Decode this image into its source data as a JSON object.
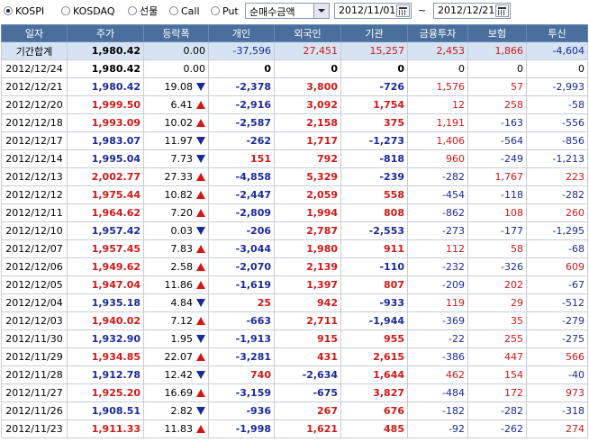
{
  "markets": [
    {
      "label": "KOSPI",
      "selected": true
    },
    {
      "label": "KOSDAQ",
      "selected": false
    },
    {
      "label": "선물",
      "selected": false
    },
    {
      "label": "Call",
      "selected": false
    },
    {
      "label": "Put",
      "selected": false
    }
  ],
  "metric_select": {
    "value": "순매수금액"
  },
  "date_from": "2012/11/01",
  "date_to": "2012/12/21",
  "range_sep": "~",
  "columns": [
    "일자",
    "주가",
    "등락폭",
    "개인",
    "외국인",
    "기관",
    "금융투자",
    "보험",
    "투신"
  ],
  "summary": {
    "date": "기간합계",
    "price": "1,980.42",
    "change": "0.00",
    "individual": "-37,596",
    "foreign": "27,451",
    "institution": "15,257",
    "fin_invest": "2,453",
    "insurance": "1,866",
    "trust": "-4,604"
  },
  "rows": [
    {
      "date": "2012/12/24",
      "price": "1,980.42",
      "change": "0.00",
      "dir": "none",
      "individual": "0",
      "foreign": "0",
      "institution": "0",
      "fin_invest": "0",
      "insurance": "0",
      "trust": "0"
    },
    {
      "date": "2012/12/21",
      "price": "1,980.42",
      "change": "19.08",
      "dir": "down",
      "individual": "-2,378",
      "foreign": "3,800",
      "institution": "-726",
      "fin_invest": "1,576",
      "insurance": "57",
      "trust": "-2,993"
    },
    {
      "date": "2012/12/20",
      "price": "1,999.50",
      "change": "6.41",
      "dir": "up",
      "individual": "-2,916",
      "foreign": "3,092",
      "institution": "1,754",
      "fin_invest": "12",
      "insurance": "258",
      "trust": "-58"
    },
    {
      "date": "2012/12/18",
      "price": "1,993.09",
      "change": "10.02",
      "dir": "up",
      "individual": "-2,587",
      "foreign": "2,158",
      "institution": "375",
      "fin_invest": "1,191",
      "insurance": "-163",
      "trust": "-556"
    },
    {
      "date": "2012/12/17",
      "price": "1,983.07",
      "change": "11.97",
      "dir": "down",
      "individual": "-262",
      "foreign": "1,717",
      "institution": "-1,273",
      "fin_invest": "1,406",
      "insurance": "-564",
      "trust": "-856"
    },
    {
      "date": "2012/12/14",
      "price": "1,995.04",
      "change": "7.73",
      "dir": "down",
      "individual": "151",
      "foreign": "792",
      "institution": "-818",
      "fin_invest": "960",
      "insurance": "-249",
      "trust": "-1,213"
    },
    {
      "date": "2012/12/13",
      "price": "2,002.77",
      "change": "27.33",
      "dir": "up",
      "individual": "-4,858",
      "foreign": "5,329",
      "institution": "-239",
      "fin_invest": "-282",
      "insurance": "1,767",
      "trust": "223"
    },
    {
      "date": "2012/12/12",
      "price": "1,975.44",
      "change": "10.82",
      "dir": "up",
      "individual": "-2,447",
      "foreign": "2,059",
      "institution": "558",
      "fin_invest": "-454",
      "insurance": "-118",
      "trust": "-282"
    },
    {
      "date": "2012/12/11",
      "price": "1,964.62",
      "change": "7.20",
      "dir": "up",
      "individual": "-2,809",
      "foreign": "1,994",
      "institution": "808",
      "fin_invest": "-862",
      "insurance": "108",
      "trust": "260"
    },
    {
      "date": "2012/12/10",
      "price": "1,957.42",
      "change": "0.03",
      "dir": "down",
      "individual": "-206",
      "foreign": "2,787",
      "institution": "-2,553",
      "fin_invest": "-273",
      "insurance": "-177",
      "trust": "-1,295"
    },
    {
      "date": "2012/12/07",
      "price": "1,957.45",
      "change": "7.83",
      "dir": "up",
      "individual": "-3,044",
      "foreign": "1,980",
      "institution": "911",
      "fin_invest": "112",
      "insurance": "58",
      "trust": "-68"
    },
    {
      "date": "2012/12/06",
      "price": "1,949.62",
      "change": "2.58",
      "dir": "up",
      "individual": "-2,070",
      "foreign": "2,139",
      "institution": "-110",
      "fin_invest": "-232",
      "insurance": "-326",
      "trust": "609"
    },
    {
      "date": "2012/12/05",
      "price": "1,947.04",
      "change": "11.86",
      "dir": "up",
      "individual": "-1,619",
      "foreign": "1,397",
      "institution": "807",
      "fin_invest": "-209",
      "insurance": "202",
      "trust": "-67"
    },
    {
      "date": "2012/12/04",
      "price": "1,935.18",
      "change": "4.84",
      "dir": "down",
      "individual": "25",
      "foreign": "942",
      "institution": "-933",
      "fin_invest": "119",
      "insurance": "29",
      "trust": "-512"
    },
    {
      "date": "2012/12/03",
      "price": "1,940.02",
      "change": "7.12",
      "dir": "up",
      "individual": "-663",
      "foreign": "2,711",
      "institution": "-1,944",
      "fin_invest": "-369",
      "insurance": "35",
      "trust": "-279"
    },
    {
      "date": "2012/11/30",
      "price": "1,932.90",
      "change": "1.95",
      "dir": "down",
      "individual": "-1,913",
      "foreign": "915",
      "institution": "955",
      "fin_invest": "-22",
      "insurance": "255",
      "trust": "-275"
    },
    {
      "date": "2012/11/29",
      "price": "1,934.85",
      "change": "22.07",
      "dir": "up",
      "individual": "-3,281",
      "foreign": "431",
      "institution": "2,615",
      "fin_invest": "-386",
      "insurance": "447",
      "trust": "566"
    },
    {
      "date": "2012/11/28",
      "price": "1,912.78",
      "change": "12.42",
      "dir": "down",
      "individual": "740",
      "foreign": "-2,634",
      "institution": "1,644",
      "fin_invest": "462",
      "insurance": "154",
      "trust": "-40"
    },
    {
      "date": "2012/11/27",
      "price": "1,925.20",
      "change": "16.69",
      "dir": "up",
      "individual": "-3,159",
      "foreign": "-675",
      "institution": "3,827",
      "fin_invest": "-484",
      "insurance": "172",
      "trust": "973"
    },
    {
      "date": "2012/11/26",
      "price": "1,908.51",
      "change": "2.82",
      "dir": "down",
      "individual": "-936",
      "foreign": "267",
      "institution": "676",
      "fin_invest": "-182",
      "insurance": "-282",
      "trust": "-318"
    },
    {
      "date": "2012/11/23",
      "price": "1,911.33",
      "change": "11.83",
      "dir": "up",
      "individual": "-1,998",
      "foreign": "1,621",
      "institution": "485",
      "fin_invest": "-92",
      "insurance": "-262",
      "trust": "274"
    }
  ],
  "colors": {
    "up": "#d01818",
    "down": "#1a2a9a",
    "header_bg": "#4a6f9c",
    "summary_bg": "#d5e3f2"
  }
}
